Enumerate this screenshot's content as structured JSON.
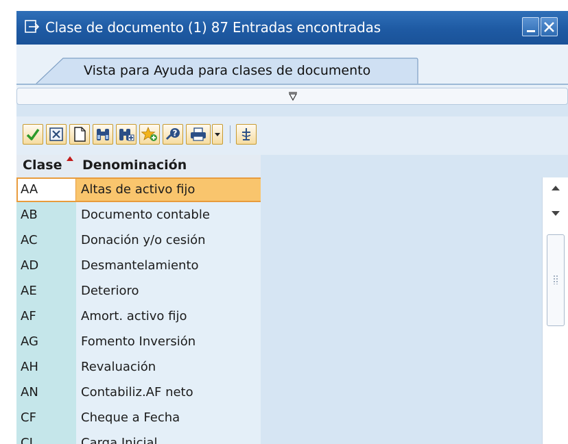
{
  "window": {
    "title": "Clase de documento (1)   87 Entradas encontradas",
    "icon": "dialog-arrow-icon"
  },
  "tab": {
    "label": "Vista para Ayuda para clases de documento"
  },
  "toolbar": {
    "buttons": [
      {
        "name": "confirm-button",
        "icon": "check-icon"
      },
      {
        "name": "cancel-button",
        "icon": "cancel-box-icon"
      },
      {
        "name": "new-button",
        "icon": "page-icon"
      },
      {
        "name": "find-button",
        "icon": "binoculars-icon"
      },
      {
        "name": "find-next-button",
        "icon": "binoculars-plus-icon"
      },
      {
        "name": "add-favorite-button",
        "icon": "star-plus-icon"
      },
      {
        "name": "help-button",
        "icon": "help-icon"
      },
      {
        "name": "print-button",
        "icon": "printer-icon"
      },
      {
        "name": "print-options-button",
        "icon": "dropdown-icon"
      },
      {
        "name": "technical-info-button",
        "icon": "pin-icon"
      }
    ]
  },
  "table": {
    "columns": [
      "Clase",
      "Denominación"
    ],
    "sorted_column": "Clase",
    "rows": [
      {
        "clase": "AA",
        "denominacion": "Altas de activo fijo",
        "selected": true
      },
      {
        "clase": "AB",
        "denominacion": "Documento contable"
      },
      {
        "clase": "AC",
        "denominacion": "Donación y/o cesión"
      },
      {
        "clase": "AD",
        "denominacion": "Desmantelamiento"
      },
      {
        "clase": "AE",
        "denominacion": "Deterioro"
      },
      {
        "clase": "AF",
        "denominacion": "Amort. activo fijo"
      },
      {
        "clase": "AG",
        "denominacion": "Fomento Inversión"
      },
      {
        "clase": "AH",
        "denominacion": "Revaluación"
      },
      {
        "clase": "AN",
        "denominacion": "Contabiliz.AF neto"
      },
      {
        "clase": "CF",
        "denominacion": "Cheque a Fecha"
      },
      {
        "clase": "CI",
        "denominacion": "Carga Inicial"
      }
    ]
  },
  "colors": {
    "titlebar": "#1e5aa3",
    "selection": "#f9c56d",
    "selection_border": "#e89b3c",
    "key_column": "#c5e6ea"
  }
}
